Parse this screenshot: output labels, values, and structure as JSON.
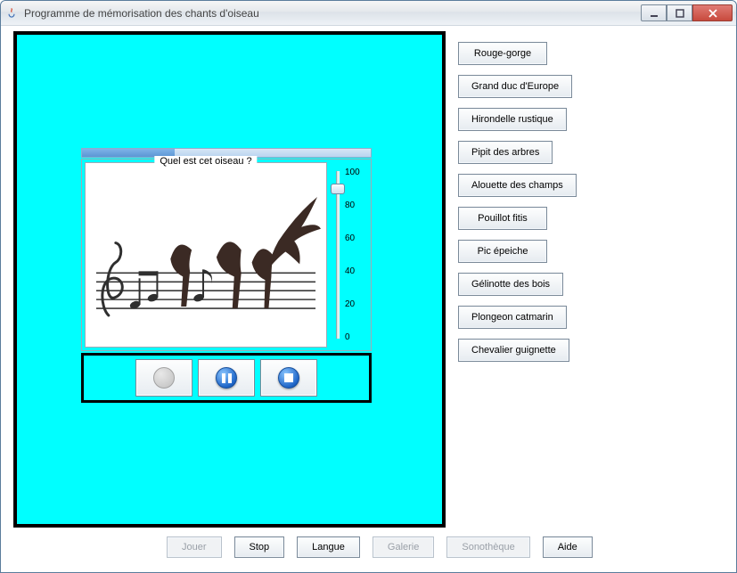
{
  "window": {
    "title": "Programme de mémorisation des chants d'oiseau"
  },
  "quiz": {
    "question": "Quel est cet oiseau ?",
    "progress_pct": 32
  },
  "slider": {
    "max": "100",
    "t80": "80",
    "t60": "60",
    "t40": "40",
    "t20": "20",
    "min": "0"
  },
  "choices": [
    "Rouge-gorge",
    "Grand duc d'Europe",
    "Hirondelle rustique",
    "Pipit des arbres",
    "Alouette des champs",
    "Pouillot fitis",
    "Pic épeiche",
    "Gélinotte des bois",
    "Plongeon catmarin",
    "Chevalier guignette"
  ],
  "commands": {
    "jouer": "Jouer",
    "stop": "Stop",
    "langue": "Langue",
    "galerie": "Galerie",
    "sono": "Sonothèque",
    "aide": "Aide"
  }
}
